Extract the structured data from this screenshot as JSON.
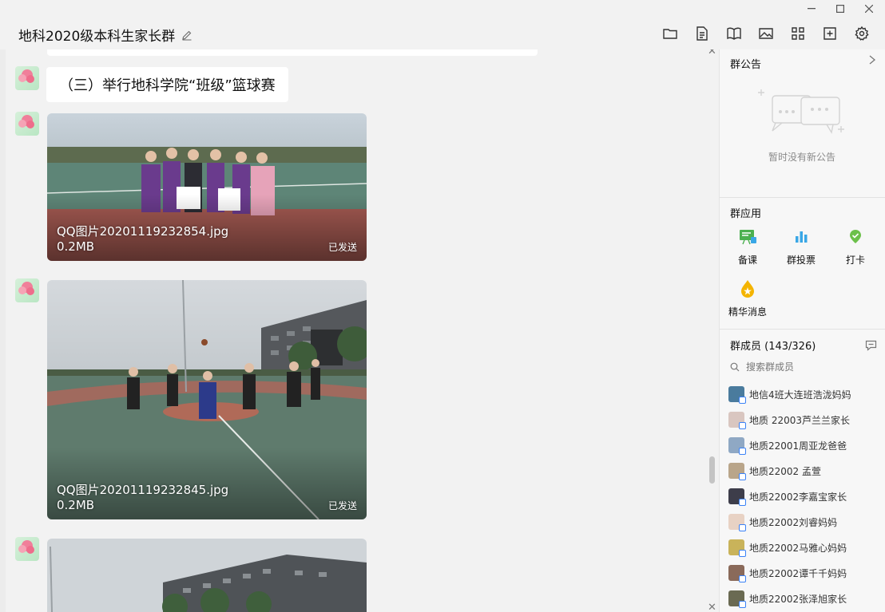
{
  "window": {
    "title": "地科2020级本科生家长群"
  },
  "chat": {
    "messages": [
      {
        "type": "text",
        "text": "（三）举行地科学院“班级”篮球赛"
      },
      {
        "type": "image",
        "filename": "QQ图片20201119232854.jpg",
        "size": "0.2MB",
        "status": "已发送"
      },
      {
        "type": "image",
        "filename": "QQ图片20201119232845.jpg",
        "size": "0.2MB",
        "status": "已发送"
      }
    ]
  },
  "side": {
    "notice": {
      "title": "群公告",
      "empty": "暂时没有新公告"
    },
    "apps": {
      "title": "群应用",
      "items": [
        {
          "label": "备课",
          "icon": "lesson-icon",
          "color": "#4cb050"
        },
        {
          "label": "群投票",
          "icon": "vote-icon",
          "color": "#3aa7e6"
        },
        {
          "label": "打卡",
          "icon": "checkin-icon",
          "color": "#6cc04a"
        },
        {
          "label": "精华消息",
          "icon": "essence-icon",
          "color": "#f4b400"
        }
      ]
    },
    "members": {
      "title": "群成员 (143/326)",
      "search_placeholder": "搜索群成员",
      "list": [
        {
          "name": "地信4班大连班浩泷妈妈",
          "color": "#4a7b9d"
        },
        {
          "name": "地质 22003芦兰兰家长",
          "color": "#d9c6c0"
        },
        {
          "name": "地质22001周亚龙爸爸",
          "color": "#8fa8c4"
        },
        {
          "name": "地质22002 孟萱",
          "color": "#b9a58a"
        },
        {
          "name": "地质22002李嘉宝家长",
          "color": "#3d3d4a"
        },
        {
          "name": "地质22002刘睿妈妈",
          "color": "#e8d2c4"
        },
        {
          "name": "地质22002马雅心妈妈",
          "color": "#c9b35a"
        },
        {
          "name": "地质22002谭千千妈妈",
          "color": "#8a6a5a"
        },
        {
          "name": "地质22002张泽旭家长",
          "color": "#6a6a52"
        }
      ]
    }
  }
}
